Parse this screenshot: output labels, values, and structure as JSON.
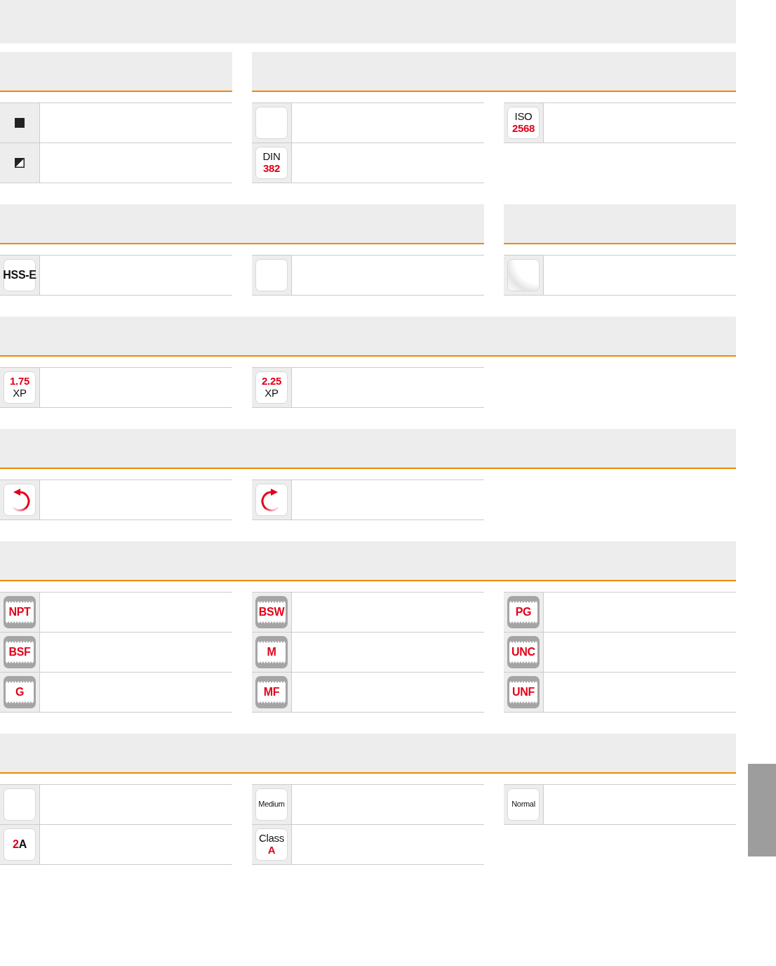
{
  "sections": [
    {
      "headers": [
        {
          "kind": "single"
        },
        {
          "kind": "double"
        }
      ],
      "columns": [
        [
          {
            "kind": "solid-square"
          },
          {
            "kind": "half-square"
          }
        ],
        [
          {
            "kind": "blank"
          },
          {
            "kind": "badge",
            "lines": [
              [
                {
                  "text": "DIN",
                  "accent": false,
                  "bold": false
                }
              ],
              [
                {
                  "text": "382",
                  "accent": true,
                  "bold": true
                }
              ]
            ]
          }
        ],
        [
          {
            "kind": "badge",
            "lines": [
              [
                {
                  "text": "ISO",
                  "accent": false,
                  "bold": false
                }
              ],
              [
                {
                  "text": "2568",
                  "accent": true,
                  "bold": true
                }
              ]
            ]
          }
        ]
      ]
    },
    {
      "headers": [
        {
          "kind": "double"
        },
        {
          "kind": "single"
        }
      ],
      "columns": [
        [
          {
            "kind": "badge",
            "lines": [
              [
                {
                  "text": "HSS-E",
                  "accent": false,
                  "bold": true
                }
              ]
            ]
          }
        ],
        [
          {
            "kind": "blank"
          }
        ],
        [
          {
            "kind": "glossy"
          }
        ]
      ]
    },
    {
      "headers": [
        {
          "kind": "triple"
        }
      ],
      "columns": [
        [
          {
            "kind": "badge",
            "lines": [
              [
                {
                  "text": "1.75",
                  "accent": true,
                  "bold": true
                }
              ],
              [
                {
                  "text": "XP",
                  "accent": false,
                  "bold": false
                }
              ]
            ]
          }
        ],
        [
          {
            "kind": "badge",
            "lines": [
              [
                {
                  "text": "2.25",
                  "accent": true,
                  "bold": true
                }
              ],
              [
                {
                  "text": "XP",
                  "accent": false,
                  "bold": false
                }
              ]
            ]
          }
        ],
        []
      ]
    },
    {
      "headers": [
        {
          "kind": "triple"
        }
      ],
      "columns": [
        [
          {
            "kind": "ccw"
          }
        ],
        [
          {
            "kind": "cw"
          }
        ],
        []
      ]
    },
    {
      "headers": [
        {
          "kind": "triple"
        }
      ],
      "columns": [
        [
          {
            "kind": "thread",
            "text": "NPT"
          },
          {
            "kind": "thread",
            "text": "BSF"
          },
          {
            "kind": "thread",
            "text": "G"
          }
        ],
        [
          {
            "kind": "thread",
            "text": "BSW"
          },
          {
            "kind": "thread",
            "text": "M"
          },
          {
            "kind": "thread",
            "text": "MF"
          }
        ],
        [
          {
            "kind": "thread",
            "text": "PG"
          },
          {
            "kind": "thread",
            "text": "UNC"
          },
          {
            "kind": "thread",
            "text": "UNF"
          }
        ]
      ]
    },
    {
      "headers": [
        {
          "kind": "triple"
        }
      ],
      "columns": [
        [
          {
            "kind": "blank"
          },
          {
            "kind": "badge",
            "lines": [
              [
                {
                  "text": "2",
                  "accent": true,
                  "bold": true
                },
                {
                  "text": "A",
                  "accent": false,
                  "bold": true
                }
              ]
            ]
          }
        ],
        [
          {
            "kind": "small-badge",
            "text": "Medium"
          },
          {
            "kind": "badge",
            "lines": [
              [
                {
                  "text": "Class",
                  "accent": false,
                  "bold": false
                }
              ],
              [
                {
                  "text": "A",
                  "accent": true,
                  "bold": true
                }
              ]
            ]
          }
        ],
        [
          {
            "kind": "small-badge",
            "text": "Normal"
          }
        ]
      ]
    }
  ]
}
